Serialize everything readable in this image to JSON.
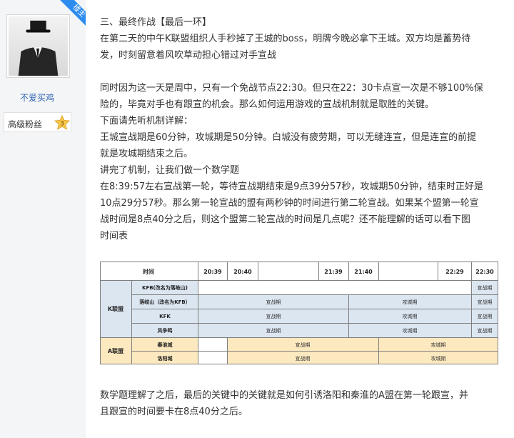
{
  "badge": {
    "louzhu": "楼主"
  },
  "user": {
    "name": "不爱买鸡",
    "fan_label": "高级粉丝",
    "fan_level": "3"
  },
  "post": {
    "lines": [
      "三、最终作战【最后一环】",
      "在第二天的中午K联盟组织人手秒掉了王城的boss，明牌今晚必拿下王城。双方均是蓄势待",
      "发，时刻留意着风吹草动担心错过对手宣战",
      "",
      "同时因为这一天是周中，只有一个免战节点22:30。但只在22：30卡点宣一次是不够100%保",
      "险的，毕竟对手也有跟宣的机会。那么如何运用游戏的宣战机制就是取胜的关键。",
      "下面请先听机制详解：",
      "王城宣战期是60分钟，攻城期是50分钟。白城没有疲劳期，可以无缝连宣，但是连宣的前提",
      "就是攻城期结束之后。",
      "讲完了机制，让我们做一个数学题",
      "在8:39:57左右宣战第一轮，等待宣战期结束是9点39分57秒，攻城期50分钟，结束时正好是",
      "10点29分57秒。那么第一轮宣战的盟有两秒钟的时间进行第二轮宣战。如果某个盟第一轮宣",
      "战时间是8点40分之后，则这个盟第二轮宣战的时间是几点呢？还不能理解的话可以看下图",
      "时间表"
    ],
    "closing": [
      "数学题理解了之后，最后的关键中的关键就是如何引诱洛阳和秦淮的A盟在第一轮跟宣，并",
      "且跟宣的时间要卡在8点40分之后。"
    ]
  },
  "timetable": {
    "header": {
      "time": "时间",
      "t1": "20:39",
      "t2": "20:40",
      "t3": "21:39",
      "t4": "21:40",
      "t5": "22:29",
      "t6": "22:30"
    },
    "k_group": "K联盟",
    "a_group": "A联盟",
    "k_rows": [
      {
        "name": "KFB(改名为落岐山)",
        "last": "宣战期"
      },
      {
        "name": "落岐山（改名为KFB）",
        "p1": "宣战期",
        "p2": "攻城期",
        "last": "宣战期"
      },
      {
        "name": "KFK",
        "p1": "宣战期",
        "p2": "攻城期",
        "last": "宣战期"
      },
      {
        "name": "风争鸣",
        "p1": "宣战期",
        "p2": "攻城期",
        "last": "宣战期"
      }
    ],
    "a_rows": [
      {
        "name": "秦淮城",
        "p1": "宣战期",
        "p2": "攻城期"
      },
      {
        "name": "洛阳城",
        "p1": "宣战期",
        "p2": "攻城期"
      }
    ],
    "colors": {
      "k_fill": "#dce6f1",
      "a_fill": "#fde9bf",
      "border": "#7f7f7f"
    }
  }
}
